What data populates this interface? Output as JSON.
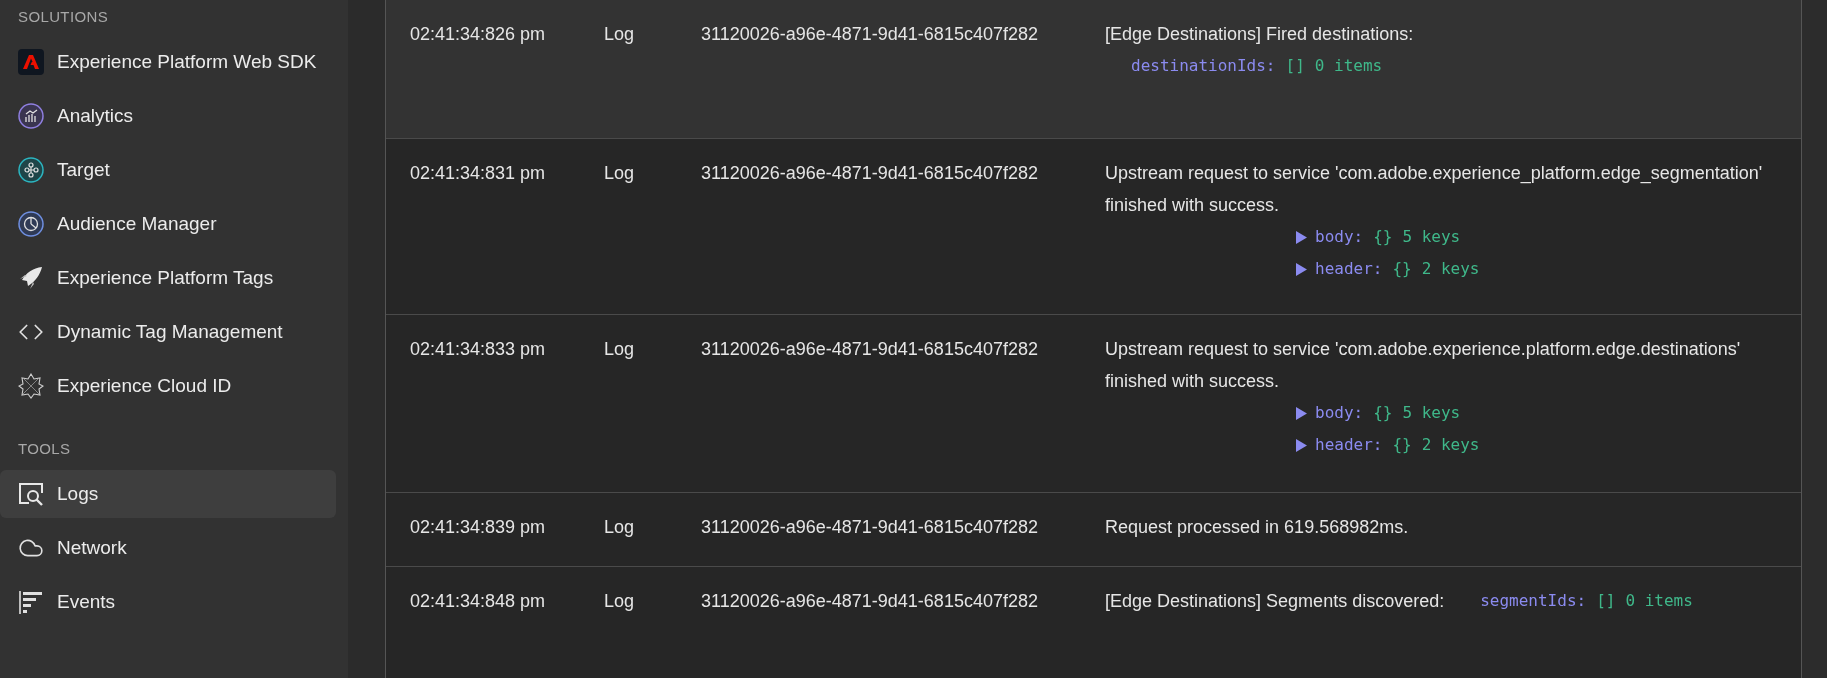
{
  "sidebar": {
    "sections": [
      {
        "title": "SOLUTIONS",
        "items": [
          {
            "label": "Experience Platform Web SDK",
            "selected": false
          },
          {
            "label": "Analytics",
            "selected": false
          },
          {
            "label": "Target",
            "selected": false
          },
          {
            "label": "Audience Manager",
            "selected": false
          },
          {
            "label": "Experience Platform Tags",
            "selected": false
          },
          {
            "label": "Dynamic Tag Management",
            "selected": false
          },
          {
            "label": "Experience Cloud ID",
            "selected": false
          }
        ]
      },
      {
        "title": "TOOLS",
        "items": [
          {
            "label": "Logs",
            "selected": true
          },
          {
            "label": "Network",
            "selected": false
          },
          {
            "label": "Events",
            "selected": false
          }
        ]
      }
    ]
  },
  "log_table": {
    "rows": [
      {
        "time": "02:41:34:826 pm",
        "level": "Log",
        "id": "31120026-a96e-4871-9d41-6815c407f282",
        "message": "[Edge Destinations] Fired destinations:",
        "kind": "below",
        "highlighted": true,
        "fields": [
          {
            "key": "destinationIds:",
            "value": "[]",
            "count": "0 items",
            "expandable": false
          }
        ]
      },
      {
        "time": "02:41:34:831 pm",
        "level": "Log",
        "id": "31120026-a96e-4871-9d41-6815c407f282",
        "message": "Upstream request to service 'com.adobe.experience_platform.edge_segmentation' finished with success.",
        "kind": "hanging",
        "highlighted": false,
        "fields": [
          {
            "key": "body:",
            "value": "{}",
            "count": "5 keys",
            "expandable": true
          },
          {
            "key": "header:",
            "value": "{}",
            "count": "2 keys",
            "expandable": true
          }
        ]
      },
      {
        "time": "02:41:34:833 pm",
        "level": "Log",
        "id": "31120026-a96e-4871-9d41-6815c407f282",
        "message": "Upstream request to service 'com.adobe.experience.platform.edge.destinations' finished with success.",
        "kind": "hanging",
        "highlighted": false,
        "fields": [
          {
            "key": "body:",
            "value": "{}",
            "count": "5 keys",
            "expandable": true
          },
          {
            "key": "header:",
            "value": "{}",
            "count": "2 keys",
            "expandable": true
          }
        ]
      },
      {
        "time": "02:41:34:839 pm",
        "level": "Log",
        "id": "31120026-a96e-4871-9d41-6815c407f282",
        "message": "Request processed in 619.568982ms.",
        "kind": "inline",
        "highlighted": false,
        "fields": []
      },
      {
        "time": "02:41:34:848 pm",
        "level": "Log",
        "id": "31120026-a96e-4871-9d41-6815c407f282",
        "message": "[Edge Destinations] Segments discovered:",
        "kind": "inline",
        "highlighted": false,
        "fields": [
          {
            "key": "segmentIds:",
            "value": "[]",
            "count": "0 items",
            "expandable": false
          }
        ]
      }
    ]
  }
}
